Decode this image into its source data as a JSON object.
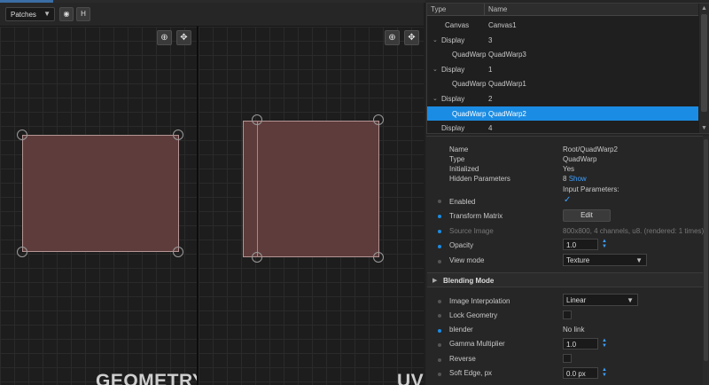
{
  "toolbar": {
    "mode_select": "Patches",
    "eye_icon": "eye-icon",
    "h_button": "H"
  },
  "viewports": {
    "geometry_label": "GEOMETRY",
    "uv_label": "UV",
    "zoom_icon": "zoom-icon",
    "move_icon": "move-icon"
  },
  "tree": {
    "columns": [
      "Type",
      "Name"
    ],
    "rows": [
      {
        "type": "Canvas",
        "name": "Canvas1",
        "indent": 0,
        "expand": false
      },
      {
        "type": "Display",
        "name": "3",
        "indent": 1,
        "expand": true
      },
      {
        "type": "QuadWarp",
        "name": "QuadWarp3",
        "indent": 2,
        "expand": false
      },
      {
        "type": "Display",
        "name": "1",
        "indent": 1,
        "expand": true
      },
      {
        "type": "QuadWarp",
        "name": "QuadWarp1",
        "indent": 2,
        "expand": false
      },
      {
        "type": "Display",
        "name": "2",
        "indent": 1,
        "expand": true
      },
      {
        "type": "QuadWarp",
        "name": "QuadWarp2",
        "indent": 2,
        "expand": false,
        "selected": true
      },
      {
        "type": "Display",
        "name": "4",
        "indent": 1,
        "expand": false
      }
    ]
  },
  "info": {
    "name_label": "Name",
    "name_value": "Root/QuadWarp2",
    "type_label": "Type",
    "type_value": "QuadWarp",
    "initialized_label": "Initialized",
    "initialized_value": "Yes",
    "hidden_label": "Hidden Parameters",
    "hidden_count": "8",
    "hidden_show": "Show",
    "input_params_label": "Input Parameters:"
  },
  "params": {
    "enabled_label": "Enabled",
    "transform_label": "Transform Matrix",
    "transform_button": "Edit",
    "source_label": "Source Image",
    "source_value": "800x800, 4 channels, u8. (rendered: 1 times)",
    "opacity_label": "Opacity",
    "opacity_value": "1.0",
    "viewmode_label": "View mode",
    "viewmode_value": "Texture",
    "blending_section": "Blending Mode",
    "interp_label": "Image Interpolation",
    "interp_value": "Linear",
    "lock_label": "Lock Geometry",
    "blender_label": "blender",
    "blender_value": "No link",
    "gamma_label": "Gamma Multiplier",
    "gamma_value": "1.0",
    "reverse_label": "Reverse",
    "soft_label": "Soft Edge, px",
    "soft_value": "0.0 px"
  },
  "colors": {
    "accent": "#1b8ce3",
    "quad_fill": "#5e3c3c"
  }
}
